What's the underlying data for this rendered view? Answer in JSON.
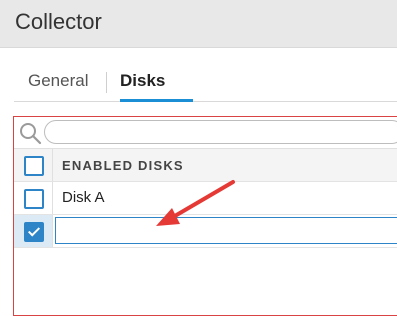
{
  "window": {
    "title": "Collector"
  },
  "tabs": [
    {
      "label": "General",
      "active": false
    },
    {
      "label": "Disks",
      "active": true
    }
  ],
  "search": {
    "value": "",
    "placeholder": ""
  },
  "table": {
    "header": "ENABLED DISKS",
    "rows": [
      {
        "label": "Disk A",
        "checked": false
      },
      {
        "label": "",
        "checked": true,
        "editing": true
      }
    ]
  },
  "annotation": {
    "color": "#e53935",
    "icon": "arrow-pointer"
  },
  "colors": {
    "accent": "#1a8fd6",
    "checkbox": "#2d84c6",
    "panel_border": "#d94343"
  }
}
